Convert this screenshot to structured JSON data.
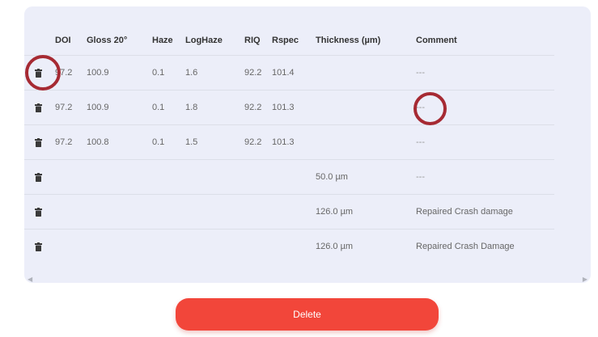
{
  "table": {
    "columns": [
      "",
      "DOI",
      "Gloss 20°",
      "Haze",
      "LogHaze",
      "RIQ",
      "Rspec",
      "Thickness (µm)",
      "Comment"
    ],
    "rows": [
      [
        "",
        "97.2",
        "100.9",
        "0.1",
        "1.6",
        "92.2",
        "101.4",
        "",
        "---"
      ],
      [
        "",
        "97.2",
        "100.9",
        "0.1",
        "1.8",
        "92.2",
        "101.3",
        "",
        "---"
      ],
      [
        "",
        "97.2",
        "100.8",
        "0.1",
        "1.5",
        "92.2",
        "101.3",
        "",
        "---"
      ],
      [
        "",
        "",
        "",
        "",
        "",
        "",
        "",
        "50.0 µm",
        "---"
      ],
      [
        "",
        "",
        "",
        "",
        "",
        "",
        "",
        "126.0 µm",
        "Repaired Crash damage"
      ],
      [
        "",
        "",
        "",
        "",
        "",
        "",
        "",
        "126.0 µm",
        "Repaired Crash Damage"
      ]
    ]
  },
  "icons": {
    "row_delete": "trash-icon",
    "scroll_left": "chevron-left-icon",
    "scroll_right": "chevron-right-icon"
  },
  "colors": {
    "panel_bg": "#eceef9",
    "delete_button": "#f2463a",
    "annotation_circle": "#a62a33"
  },
  "actions": {
    "delete_label": "Delete"
  }
}
